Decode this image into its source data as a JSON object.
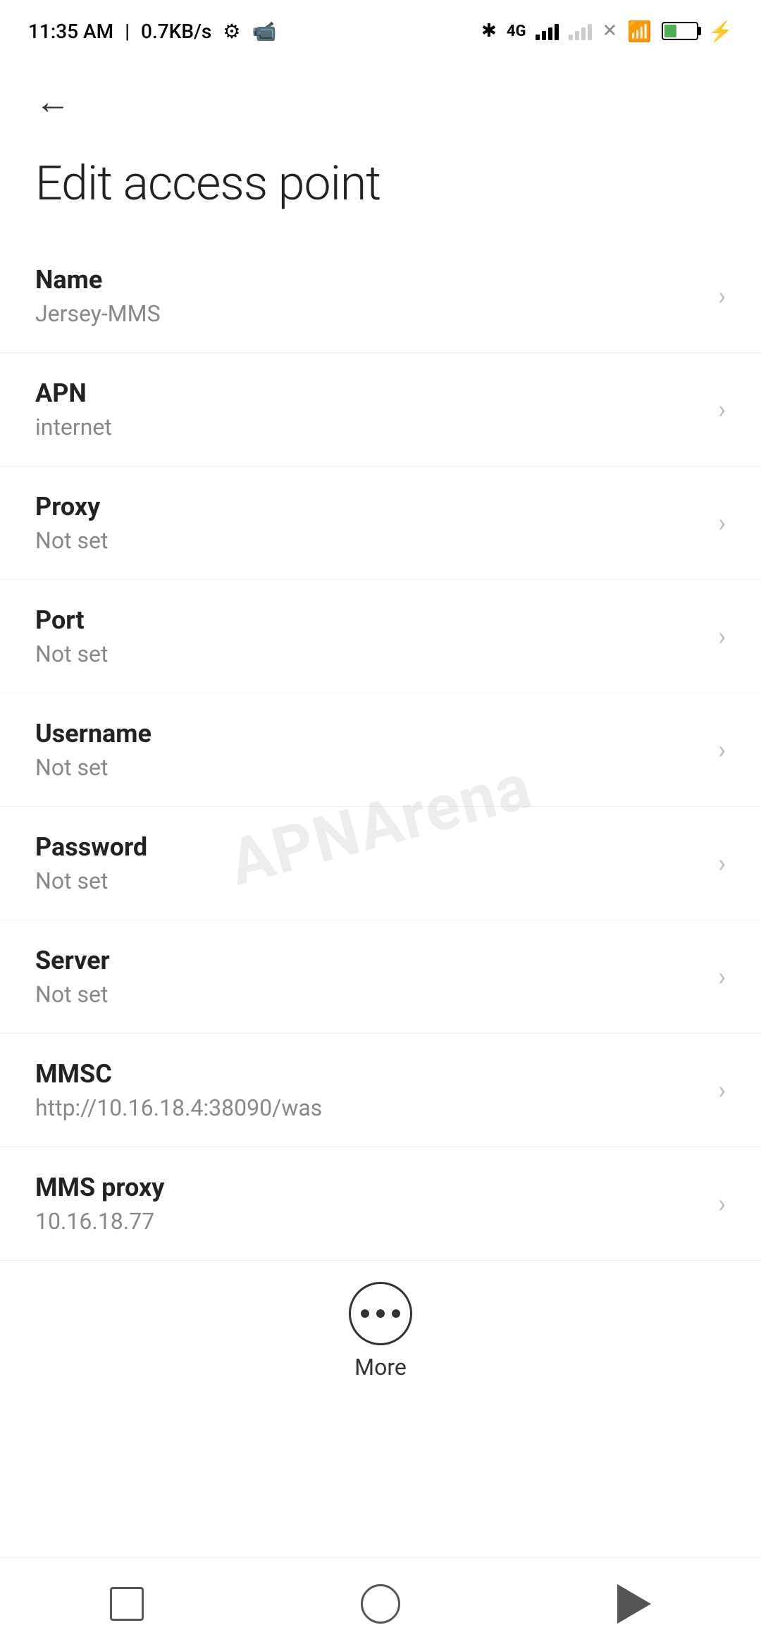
{
  "statusBar": {
    "time": "11:35 AM",
    "speed": "0.7KB/s",
    "batteryPercent": "38"
  },
  "nav": {
    "backLabel": "←"
  },
  "pageTitle": "Edit access point",
  "items": [
    {
      "label": "Name",
      "value": "Jersey-MMS"
    },
    {
      "label": "APN",
      "value": "internet"
    },
    {
      "label": "Proxy",
      "value": "Not set"
    },
    {
      "label": "Port",
      "value": "Not set"
    },
    {
      "label": "Username",
      "value": "Not set"
    },
    {
      "label": "Password",
      "value": "Not set"
    },
    {
      "label": "Server",
      "value": "Not set"
    },
    {
      "label": "MMSC",
      "value": "http://10.16.18.4:38090/was"
    },
    {
      "label": "MMS proxy",
      "value": "10.16.18.77"
    }
  ],
  "moreButton": {
    "label": "More"
  },
  "watermark": "APNArena"
}
